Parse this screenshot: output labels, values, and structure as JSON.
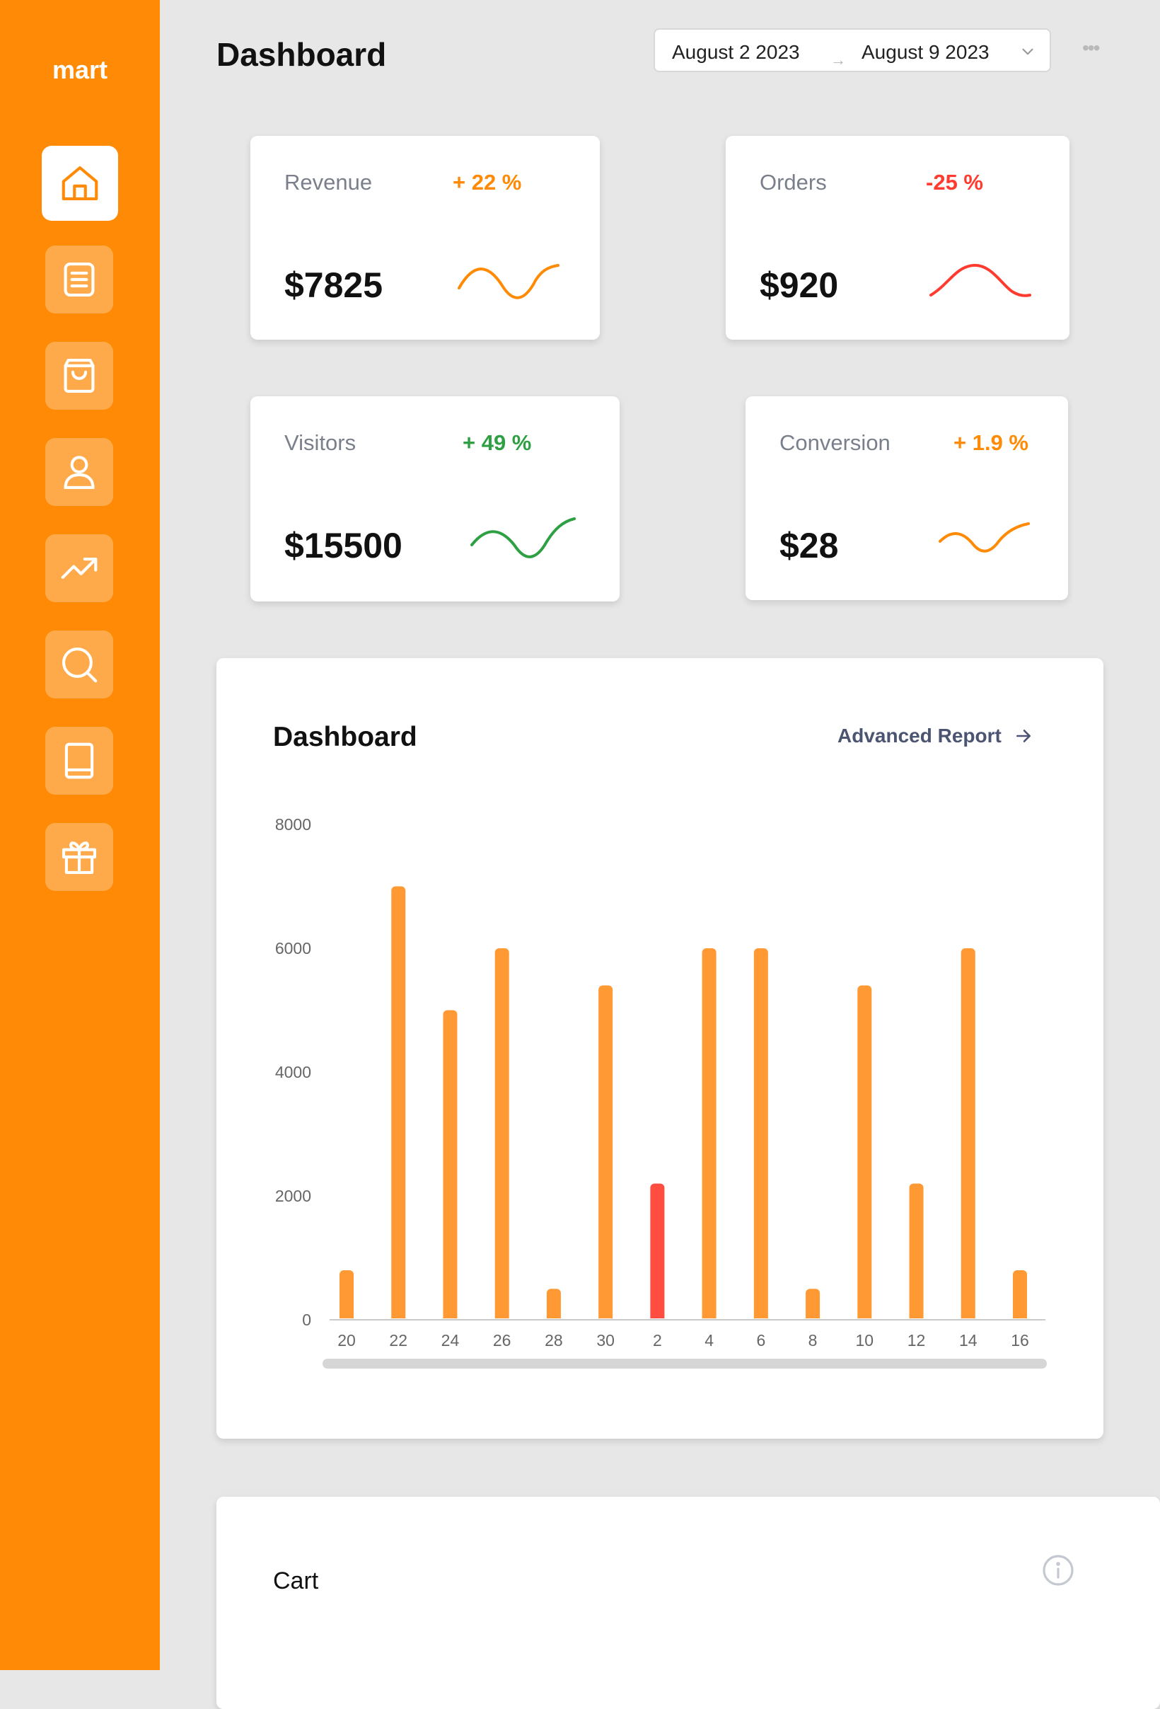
{
  "app": {
    "brand": "mart"
  },
  "header": {
    "title": "Dashboard",
    "date_start": "August 2 2023",
    "date_separator": "→",
    "date_end": "August 9 2023",
    "more": "•••"
  },
  "sidebar": {
    "items": [
      {
        "icon": "home-icon",
        "active": true
      },
      {
        "icon": "document-icon"
      },
      {
        "icon": "shopping-bag-icon"
      },
      {
        "icon": "user-icon"
      },
      {
        "icon": "trending-up-icon"
      },
      {
        "icon": "search-icon"
      },
      {
        "icon": "book-icon"
      },
      {
        "icon": "gift-icon"
      }
    ]
  },
  "stats": [
    {
      "label": "Revenue",
      "change": "+ 22 %",
      "value": "$7825",
      "color": "#ff8a05"
    },
    {
      "label": "Orders",
      "change": "-25 %",
      "value": "$920",
      "color": "#ff3b30"
    },
    {
      "label": "Visitors",
      "change": "+ 49 %",
      "value": "$15500",
      "color": "#2ea043"
    },
    {
      "label": "Conversion",
      "change": "+ 1.9 %",
      "value": "$28",
      "color": "#ff8a05"
    }
  ],
  "chart_panel": {
    "title": "Dashboard",
    "link": "Advanced Report"
  },
  "chart_data": {
    "type": "bar",
    "categories": [
      "20",
      "22",
      "24",
      "26",
      "28",
      "30",
      "2",
      "4",
      "6",
      "8",
      "10",
      "12",
      "14",
      "16"
    ],
    "values": [
      800,
      7000,
      5000,
      6000,
      500,
      5400,
      2200,
      6000,
      6000,
      500,
      5400,
      2200,
      6000,
      800
    ],
    "highlight_index": 6,
    "yticks": [
      0,
      2000,
      4000,
      6000,
      8000
    ],
    "ylim": [
      0,
      8000
    ],
    "bar_color": "#ff9933",
    "highlight_color": "#ff4d40"
  },
  "cart_panel": {
    "title": "Cart"
  }
}
